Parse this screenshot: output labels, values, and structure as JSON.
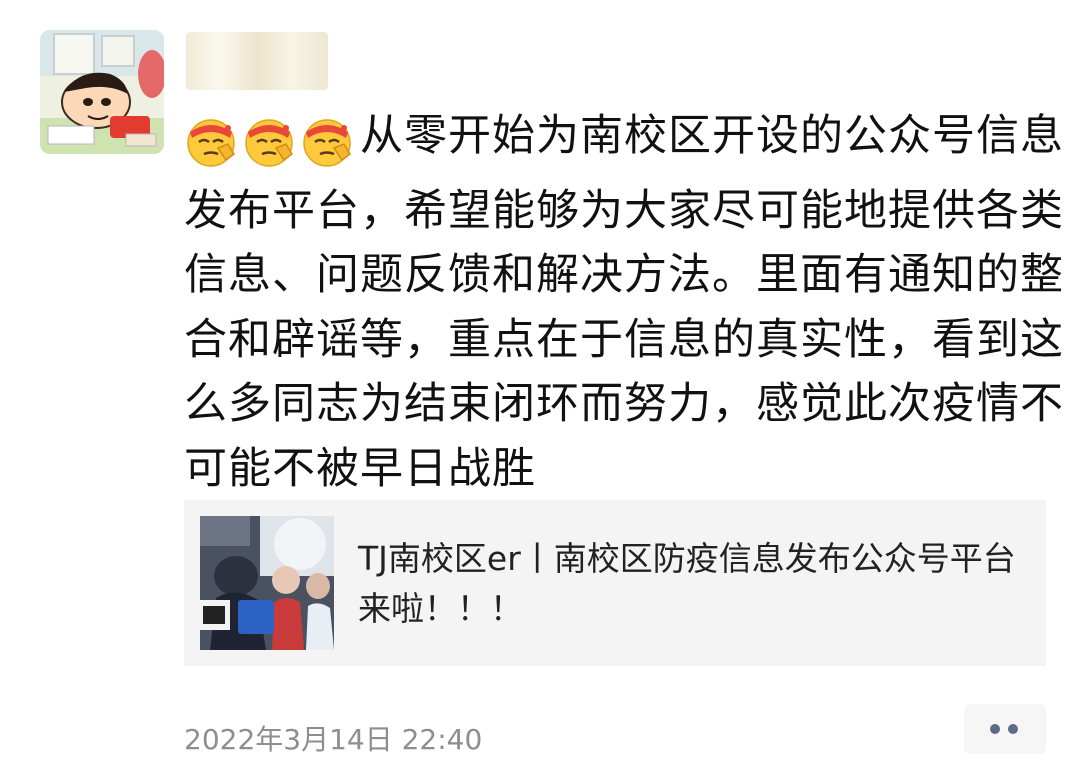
{
  "post": {
    "avatar_icon": "crayon-shinchan-avatar-icon",
    "username": "",
    "emoji_icon": "salute-emoji-icon",
    "emoji_count": 3,
    "text": "从零开始为南校区开设的公众号信息发布平台，希望能够为大家尽可能地提供各类信息、问题反馈和解决方法。里面有通知的整合和辟谣等，重点在于信息的真实性，看到这么多同志为结束闭环而努力，感觉此次疫情不可能不被早日战胜"
  },
  "link_card": {
    "thumbnail_icon": "article-thumbnail-image",
    "title": "TJ南校区er丨南校区防疫信息发布公众号平台来啦！！！"
  },
  "footer": {
    "timestamp": "2022年3月14日 22:40",
    "more_icon": "more-options-icon"
  },
  "colors": {
    "timestamp": "#8e8e8e",
    "card_background": "#f4f4f4",
    "more_dots": "#5c6b86"
  }
}
